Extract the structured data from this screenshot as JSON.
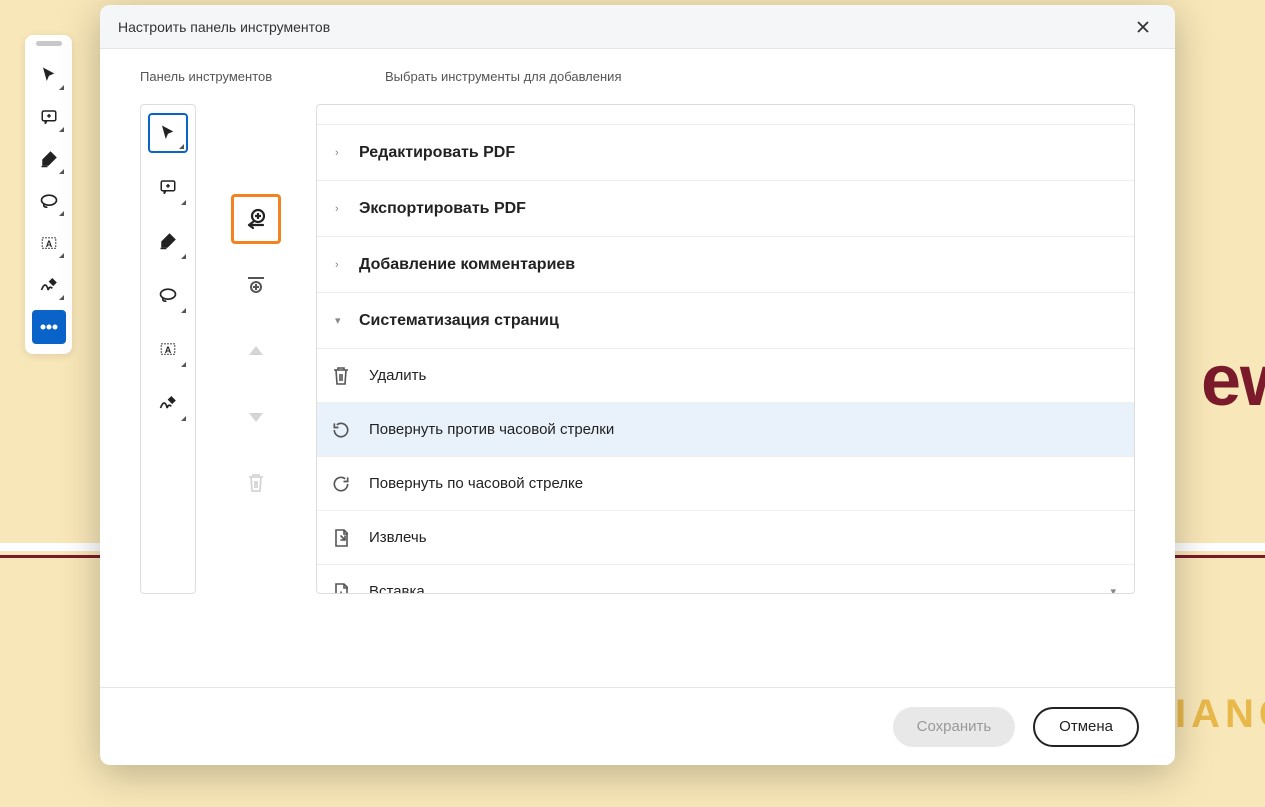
{
  "bg": {
    "text1": "ew",
    "text2": "IANG"
  },
  "leftToolbar": {
    "items": [
      {
        "name": "cursor-icon"
      },
      {
        "name": "comment-icon"
      },
      {
        "name": "highlight-icon"
      },
      {
        "name": "lasso-icon"
      },
      {
        "name": "textbox-icon"
      },
      {
        "name": "signature-icon"
      },
      {
        "name": "more-icon"
      }
    ]
  },
  "dialog": {
    "title": "Настроить панель инструментов",
    "colHeader1": "Панель инструментов",
    "colHeader2": "Выбрать инструменты для добавления",
    "saveLabel": "Сохранить",
    "cancelLabel": "Отмена"
  },
  "panelItems": [
    {
      "name": "cursor-icon",
      "selected": true
    },
    {
      "name": "comment-icon"
    },
    {
      "name": "highlight-icon"
    },
    {
      "name": "lasso-icon"
    },
    {
      "name": "textbox-icon"
    },
    {
      "name": "signature-icon"
    }
  ],
  "controls": [
    {
      "name": "add-tool-button",
      "highlighted": true
    },
    {
      "name": "add-separator-button"
    },
    {
      "name": "move-up-button",
      "disabled": true
    },
    {
      "name": "move-down-button",
      "disabled": true
    },
    {
      "name": "delete-button",
      "disabled": true
    }
  ],
  "categories": [
    {
      "label": "Редактировать PDF",
      "expanded": false
    },
    {
      "label": "Экспортировать PDF",
      "expanded": false
    },
    {
      "label": "Добавление комментариев",
      "expanded": false
    },
    {
      "label": "Систематизация страниц",
      "expanded": true,
      "tools": [
        {
          "icon": "trash-icon",
          "label": "Удалить"
        },
        {
          "icon": "rotate-ccw-icon",
          "label": "Повернуть против часовой стрелки",
          "hovered": true
        },
        {
          "icon": "rotate-cw-icon",
          "label": "Повернуть по часовой стрелке"
        },
        {
          "icon": "extract-icon",
          "label": "Извлечь"
        },
        {
          "icon": "insert-icon",
          "label": "Вставка",
          "hasExpand": true
        }
      ]
    }
  ]
}
